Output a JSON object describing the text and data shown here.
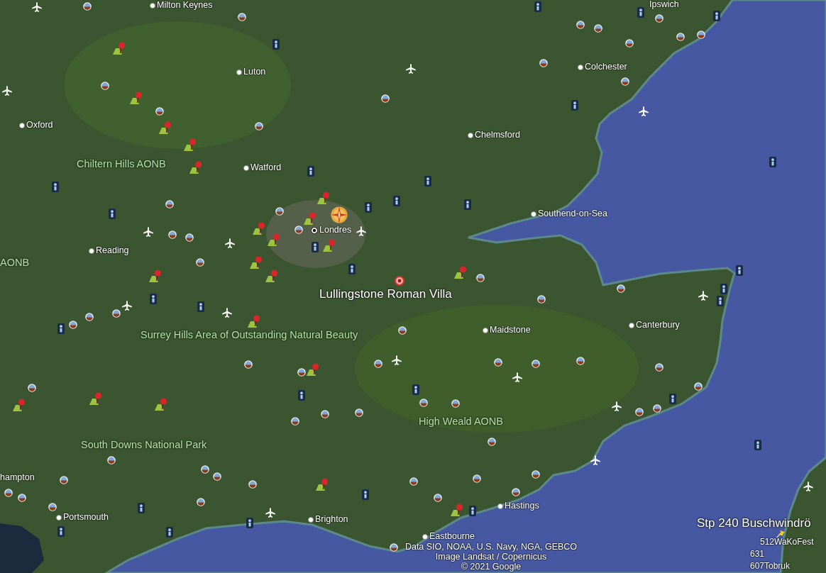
{
  "map": {
    "places": [
      {
        "kind": "city",
        "text": "Milton Keynes"
      },
      {
        "kind": "text",
        "text": "Ipswich"
      },
      {
        "kind": "city",
        "text": "Luton"
      },
      {
        "kind": "city",
        "text": "Colchester"
      },
      {
        "kind": "city",
        "text": "Oxford"
      },
      {
        "kind": "city",
        "text": "Chelmsford"
      },
      {
        "kind": "region",
        "text": "Chiltern Hills AONB"
      },
      {
        "kind": "city",
        "text": "Watford"
      },
      {
        "kind": "city",
        "text": "Southend-on-Sea"
      },
      {
        "kind": "capital",
        "text": "Londres"
      },
      {
        "kind": "city",
        "text": "Reading"
      },
      {
        "kind": "region",
        "text": "AONB"
      },
      {
        "kind": "placemark",
        "text": "Lullingstone Roman Villa"
      },
      {
        "kind": "city",
        "text": "Maidstone"
      },
      {
        "kind": "city",
        "text": "Canterbury"
      },
      {
        "kind": "region",
        "text": "Surrey Hills Area of Outstanding Natural Beauty"
      },
      {
        "kind": "region",
        "text": "High Weald AONB"
      },
      {
        "kind": "region",
        "text": "South Downs National Park"
      },
      {
        "kind": "text",
        "text": "hampton"
      },
      {
        "kind": "city",
        "text": "Hastings"
      },
      {
        "kind": "city",
        "text": "Portsmouth"
      },
      {
        "kind": "city",
        "text": "Brighton"
      },
      {
        "kind": "city",
        "text": "Eastbourne"
      },
      {
        "kind": "feature",
        "text": "Stp 240 Buschwindrö"
      },
      {
        "kind": "feature_small",
        "text": "512WaKoFest"
      },
      {
        "kind": "feature_small",
        "text": "631"
      },
      {
        "kind": "feature_small",
        "text": "607Tobruk"
      }
    ],
    "attribution": [
      "Data SIO, NOAA, U.S. Navy, NGA, GEBCO",
      "Image Landsat / Copernicus",
      "© 2021 Google"
    ]
  }
}
